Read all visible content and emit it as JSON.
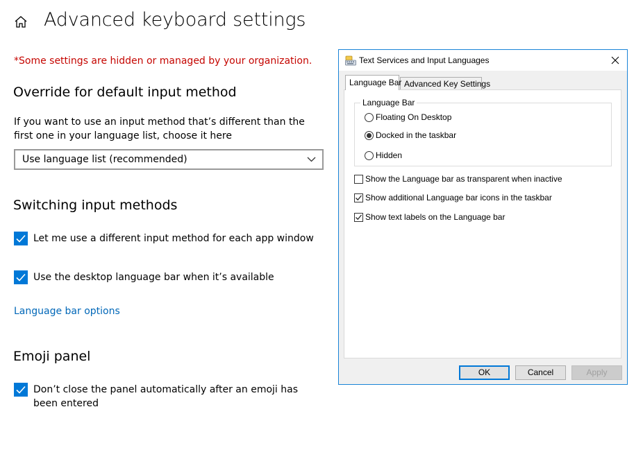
{
  "page": {
    "title": "Advanced keyboard settings",
    "managed_warning": "*Some settings are hidden or managed by your organization."
  },
  "override": {
    "heading": "Override for default input method",
    "description": "If you want to use an input method that’s different than the first one in your language list, choose it here",
    "dropdown_value": "Use language list (recommended)"
  },
  "switching": {
    "heading": "Switching input methods",
    "options": [
      {
        "label": "Let me use a different input method for each app window",
        "checked": true
      },
      {
        "label": "Use the desktop language bar when it’s available",
        "checked": true
      }
    ],
    "link": "Language bar options"
  },
  "emoji": {
    "heading": "Emoji panel",
    "option": {
      "label": "Don’t close the panel automatically after an emoji has been entered",
      "checked": true
    }
  },
  "dialog": {
    "title": "Text Services and Input Languages",
    "tabs": [
      "Language Bar",
      "Advanced Key Settings"
    ],
    "group_label": "Language Bar",
    "radios": [
      {
        "label": "Floating On Desktop",
        "selected": false
      },
      {
        "label": "Docked in the taskbar",
        "selected": true
      },
      {
        "label": "Hidden",
        "selected": false
      }
    ],
    "checkboxes": [
      {
        "label": "Show the Language bar as transparent when inactive",
        "checked": false
      },
      {
        "label": "Show additional Language bar icons in the taskbar",
        "checked": true
      },
      {
        "label": "Show text labels on the Language bar",
        "checked": true
      }
    ],
    "buttons": {
      "ok": "OK",
      "cancel": "Cancel",
      "apply": "Apply"
    }
  },
  "colors": {
    "accent": "#0078d7",
    "warning": "#c50500",
    "link": "#0067b8"
  }
}
